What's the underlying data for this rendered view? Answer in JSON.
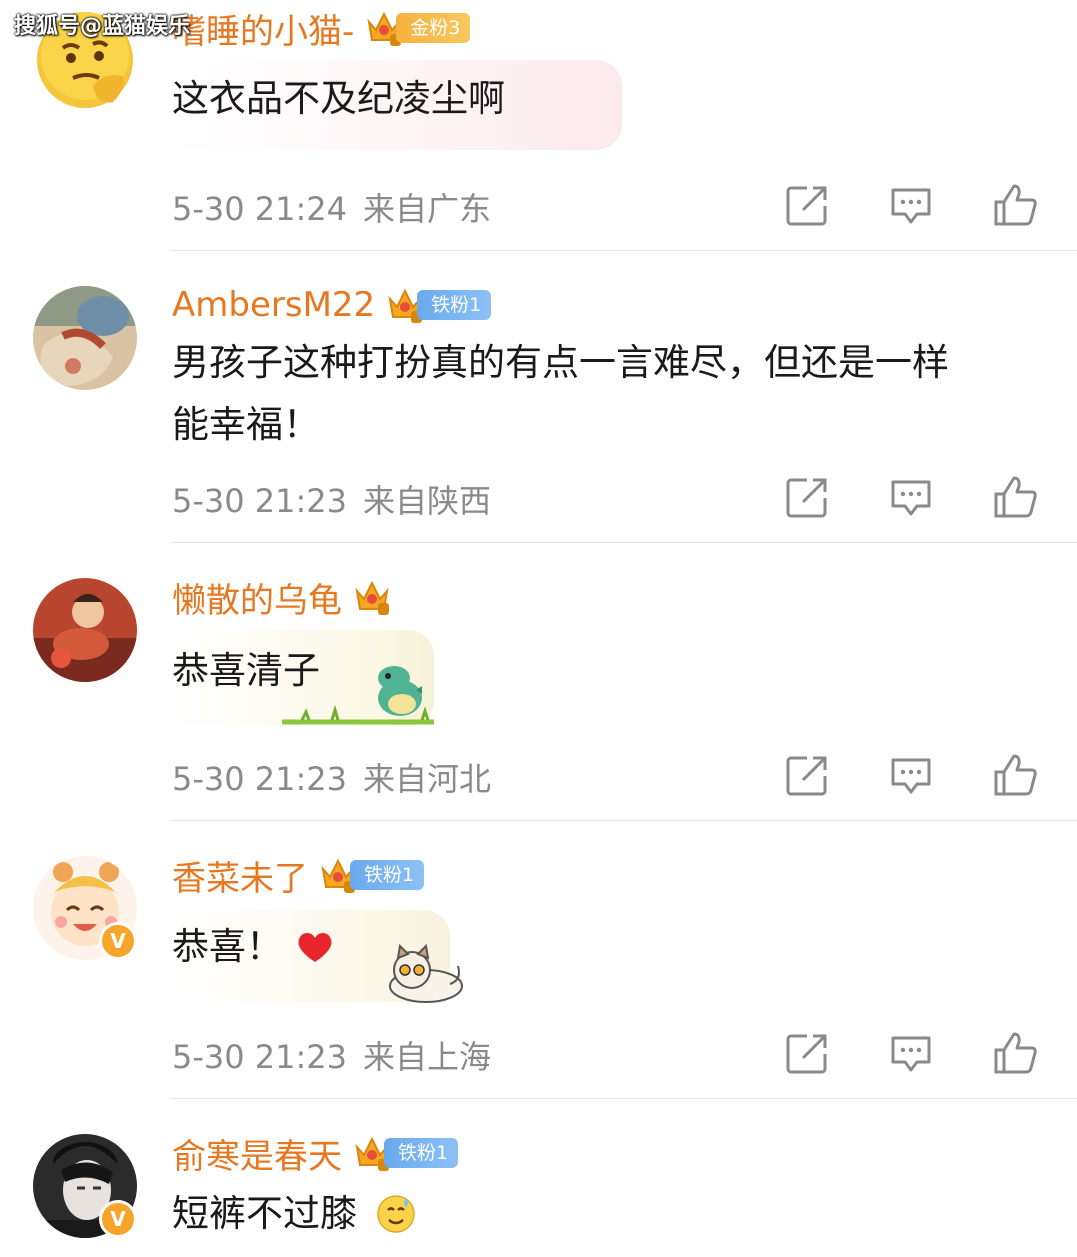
{
  "watermark": "搜狐号@蓝猫娱乐",
  "comments": [
    {
      "username": "嗜睡的小猫-",
      "badge": "金粉3",
      "text_lines": [
        "这衣品不及纪凌尘啊"
      ],
      "time": "5-30 21:24",
      "location": "来自广东"
    },
    {
      "username": "AmbersM22",
      "badge": "铁粉1",
      "text_lines": [
        "男孩子这种打扮真的有点一言难尽，但还是一样",
        "能幸福！"
      ],
      "time": "5-30 21:23",
      "location": "来自陕西"
    },
    {
      "username": "懒散的乌龟",
      "text_lines": [
        "恭喜清子"
      ],
      "time": "5-30 21:23",
      "location": "来自河北"
    },
    {
      "username": "香菜未了",
      "badge": "铁粉1",
      "text_lines": [
        "恭喜！"
      ],
      "time": "5-30 21:23",
      "location": "来自上海"
    },
    {
      "username": "俞寒是春天",
      "badge": "铁粉1",
      "text_lines": [
        "短裤不过膝"
      ],
      "time": "",
      "location": ""
    }
  ],
  "icons": {
    "share": "share-icon",
    "reply": "comment-icon",
    "like": "thumbs-up-icon",
    "crown": "crown-icon",
    "verified": "verified-v-icon"
  },
  "colors": {
    "username": "#e8781f",
    "meta": "#8a8a8a",
    "gold_badge": "#f6b23e",
    "iron_badge": "#6aa9ee"
  }
}
